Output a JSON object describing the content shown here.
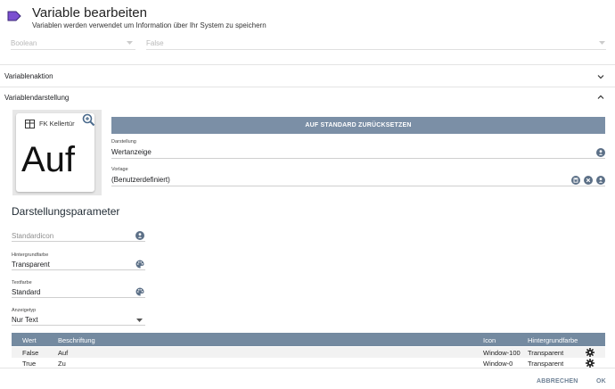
{
  "header": {
    "title": "Variable bearbeiten",
    "subtitle": "Variablen werden verwendet um Information über Ihr System zu speichern"
  },
  "type_fields": {
    "type_value": "Boolean",
    "value_value": "False"
  },
  "sections": {
    "action_label": "Variablenaktion",
    "display_label": "Variablendarstellung"
  },
  "preview": {
    "name": "FK Kellertür",
    "value": "Auf"
  },
  "reset_button": "AUF STANDARD ZURÜCKSETZEN",
  "presentation": {
    "label": "Darstellung",
    "value": "Wertanzeige"
  },
  "template": {
    "label": "Vorlage",
    "value": "(Benutzerdefiniert)"
  },
  "params": {
    "title": "Darstellungsparameter",
    "default_icon_placeholder": "Standardicon",
    "background_label": "Hintergrundfarbe",
    "background_value": "Transparent",
    "text_color_label": "Textfarbe",
    "text_color_value": "Standard",
    "display_type_label": "Anzeigetyp",
    "display_type_value": "Nur Text"
  },
  "table": {
    "headers": [
      "Wert",
      "Beschriftung",
      "Icon",
      "Hintergrundfarbe"
    ],
    "rows": [
      {
        "value": "False",
        "caption": "Auf",
        "icon": "Window-100",
        "background": "Transparent"
      },
      {
        "value": "True",
        "caption": "Zu",
        "icon": "Window-0",
        "background": "Transparent"
      }
    ]
  },
  "footer": {
    "cancel": "ABBRECHEN",
    "ok": "OK"
  },
  "colors": {
    "accent": "#7b8fa6",
    "table_header": "#748aa0",
    "tag_icon": "#6a3fb5",
    "footer_text": "#6f8296"
  }
}
